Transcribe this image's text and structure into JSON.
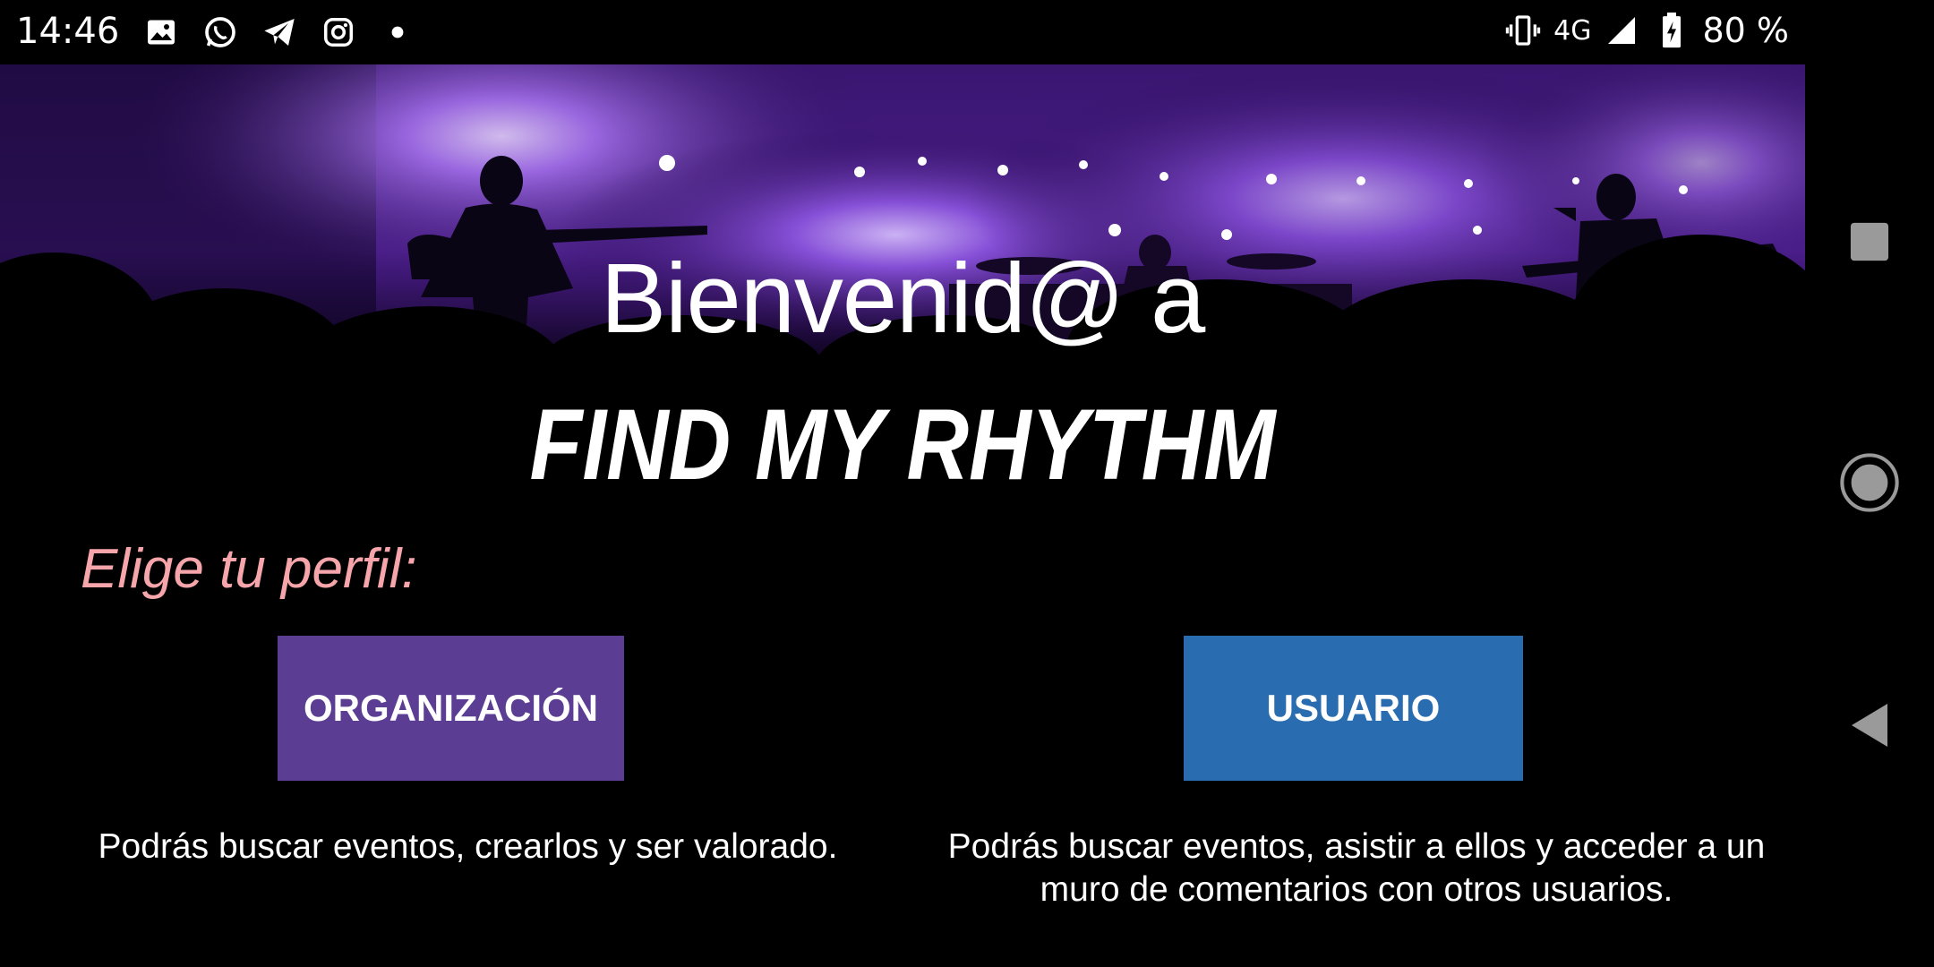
{
  "status_bar": {
    "time": "14:46",
    "network": "4G",
    "battery": "80 %",
    "left_icons": [
      "image-icon",
      "whatsapp-icon",
      "telegram-icon",
      "instagram-icon",
      "dot-icon"
    ],
    "right_icons": [
      "vibrate-icon",
      "signal-icon",
      "battery-icon"
    ]
  },
  "welcome": {
    "line1": "Bienvenid@ a",
    "app_name": "FIND MY RHYTHM"
  },
  "profile": {
    "prompt": "Elige tu perfil:",
    "organization": {
      "label": "ORGANIZACIÓN",
      "description": "Podrás buscar eventos, crearlos y ser valorado."
    },
    "user": {
      "label": "USUARIO",
      "description": "Podrás buscar eventos, asistir a ellos y acceder a un muro de comentarios con otros usuarios."
    }
  },
  "colors": {
    "background": "#000000",
    "prompt": "#f6a5ab",
    "organization_button": "#5b3d93",
    "user_button": "#2a6cb0",
    "banner_glow": "#8a4fe0"
  },
  "nav_bar": {
    "icons": [
      "recents-icon",
      "home-icon",
      "back-icon"
    ]
  }
}
